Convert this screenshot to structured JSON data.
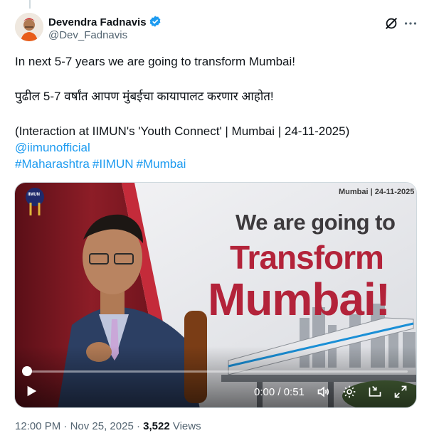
{
  "author": {
    "name": "Devendra Fadnavis",
    "handle": "@Dev_Fadnavis",
    "verified": true
  },
  "tweet": {
    "line1": "In next 5-7 years we are going to transform Mumbai!",
    "line2": "पुढील 5-7 वर्षांत आपण मुंबईचा कायापालट करणार आहोत!",
    "line3": "(Interaction at IIMUN's 'Youth Connect' | Mumbai | 24-11-2025)",
    "mention": "@iimunofficial",
    "hashtags": [
      "#Maharashtra",
      "#IIMUN",
      "#Mumbai"
    ]
  },
  "media": {
    "logo_text": "IIMUN",
    "date_label": "Mumbai | 24-11-2025",
    "headline_1": "We are going to",
    "headline_2": "Transform",
    "headline_3": "Mumbai!",
    "time_display": "0:00 / 0:51",
    "progress_fraction": 0.0
  },
  "footer": {
    "time": "12:00 PM",
    "separator": "·",
    "date": "Nov 25, 2025",
    "views_count": "3,522",
    "views_label": "Views"
  },
  "icons": {
    "verified": "verified-badge-icon",
    "grok": "grok-icon",
    "more": "more-icon",
    "play": "play-icon",
    "volume": "volume-icon",
    "settings": "settings-icon",
    "picture_in_picture": "pip-icon",
    "fullscreen": "fullscreen-icon"
  },
  "colors": {
    "link": "#1d9bf0",
    "headline_red": "#b3233a",
    "muted": "#536471"
  }
}
